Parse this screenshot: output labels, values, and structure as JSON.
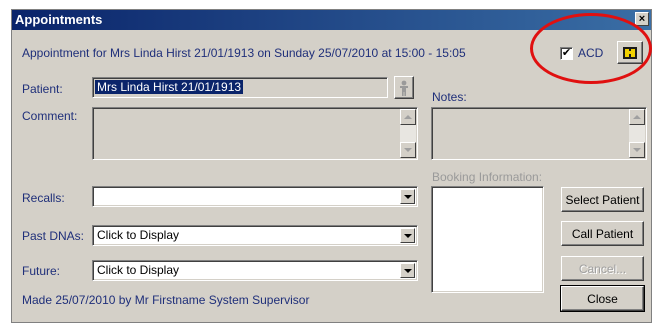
{
  "window": {
    "title": "Appointments",
    "close_glyph": "×"
  },
  "header": {
    "summary": "Appointment for Mrs Linda Hirst 21/01/1913 on Sunday 25/07/2010 at 15:00 - 15:05",
    "acd_label": "ACD",
    "acd_checked": true,
    "acd_check_glyph": "✔"
  },
  "patient": {
    "label": "Patient:",
    "value": "Mrs Linda Hirst 21/01/1913",
    "lookup_icon": "person-icon"
  },
  "notes": {
    "label": "Notes:"
  },
  "comment": {
    "label": "Comment:"
  },
  "booking": {
    "label": "Booking Information:"
  },
  "recalls": {
    "label": "Recalls:",
    "value": ""
  },
  "past_dnas": {
    "label": "Past DNAs:",
    "value": "Click to Display"
  },
  "future": {
    "label": "Future:",
    "value": "Click to Display"
  },
  "footer": {
    "made_by": "Made 25/07/2010 by Mr Firstname System Supervisor"
  },
  "buttons": {
    "select_patient": "Select Patient",
    "call_patient": "Call Patient",
    "cancel": "Cancel...",
    "close": "Close"
  },
  "colors": {
    "label_text": "#1f2f7a",
    "titlebar": "#0a246a",
    "highlight": "#0a246a",
    "annotation_ring": "#e01010"
  }
}
